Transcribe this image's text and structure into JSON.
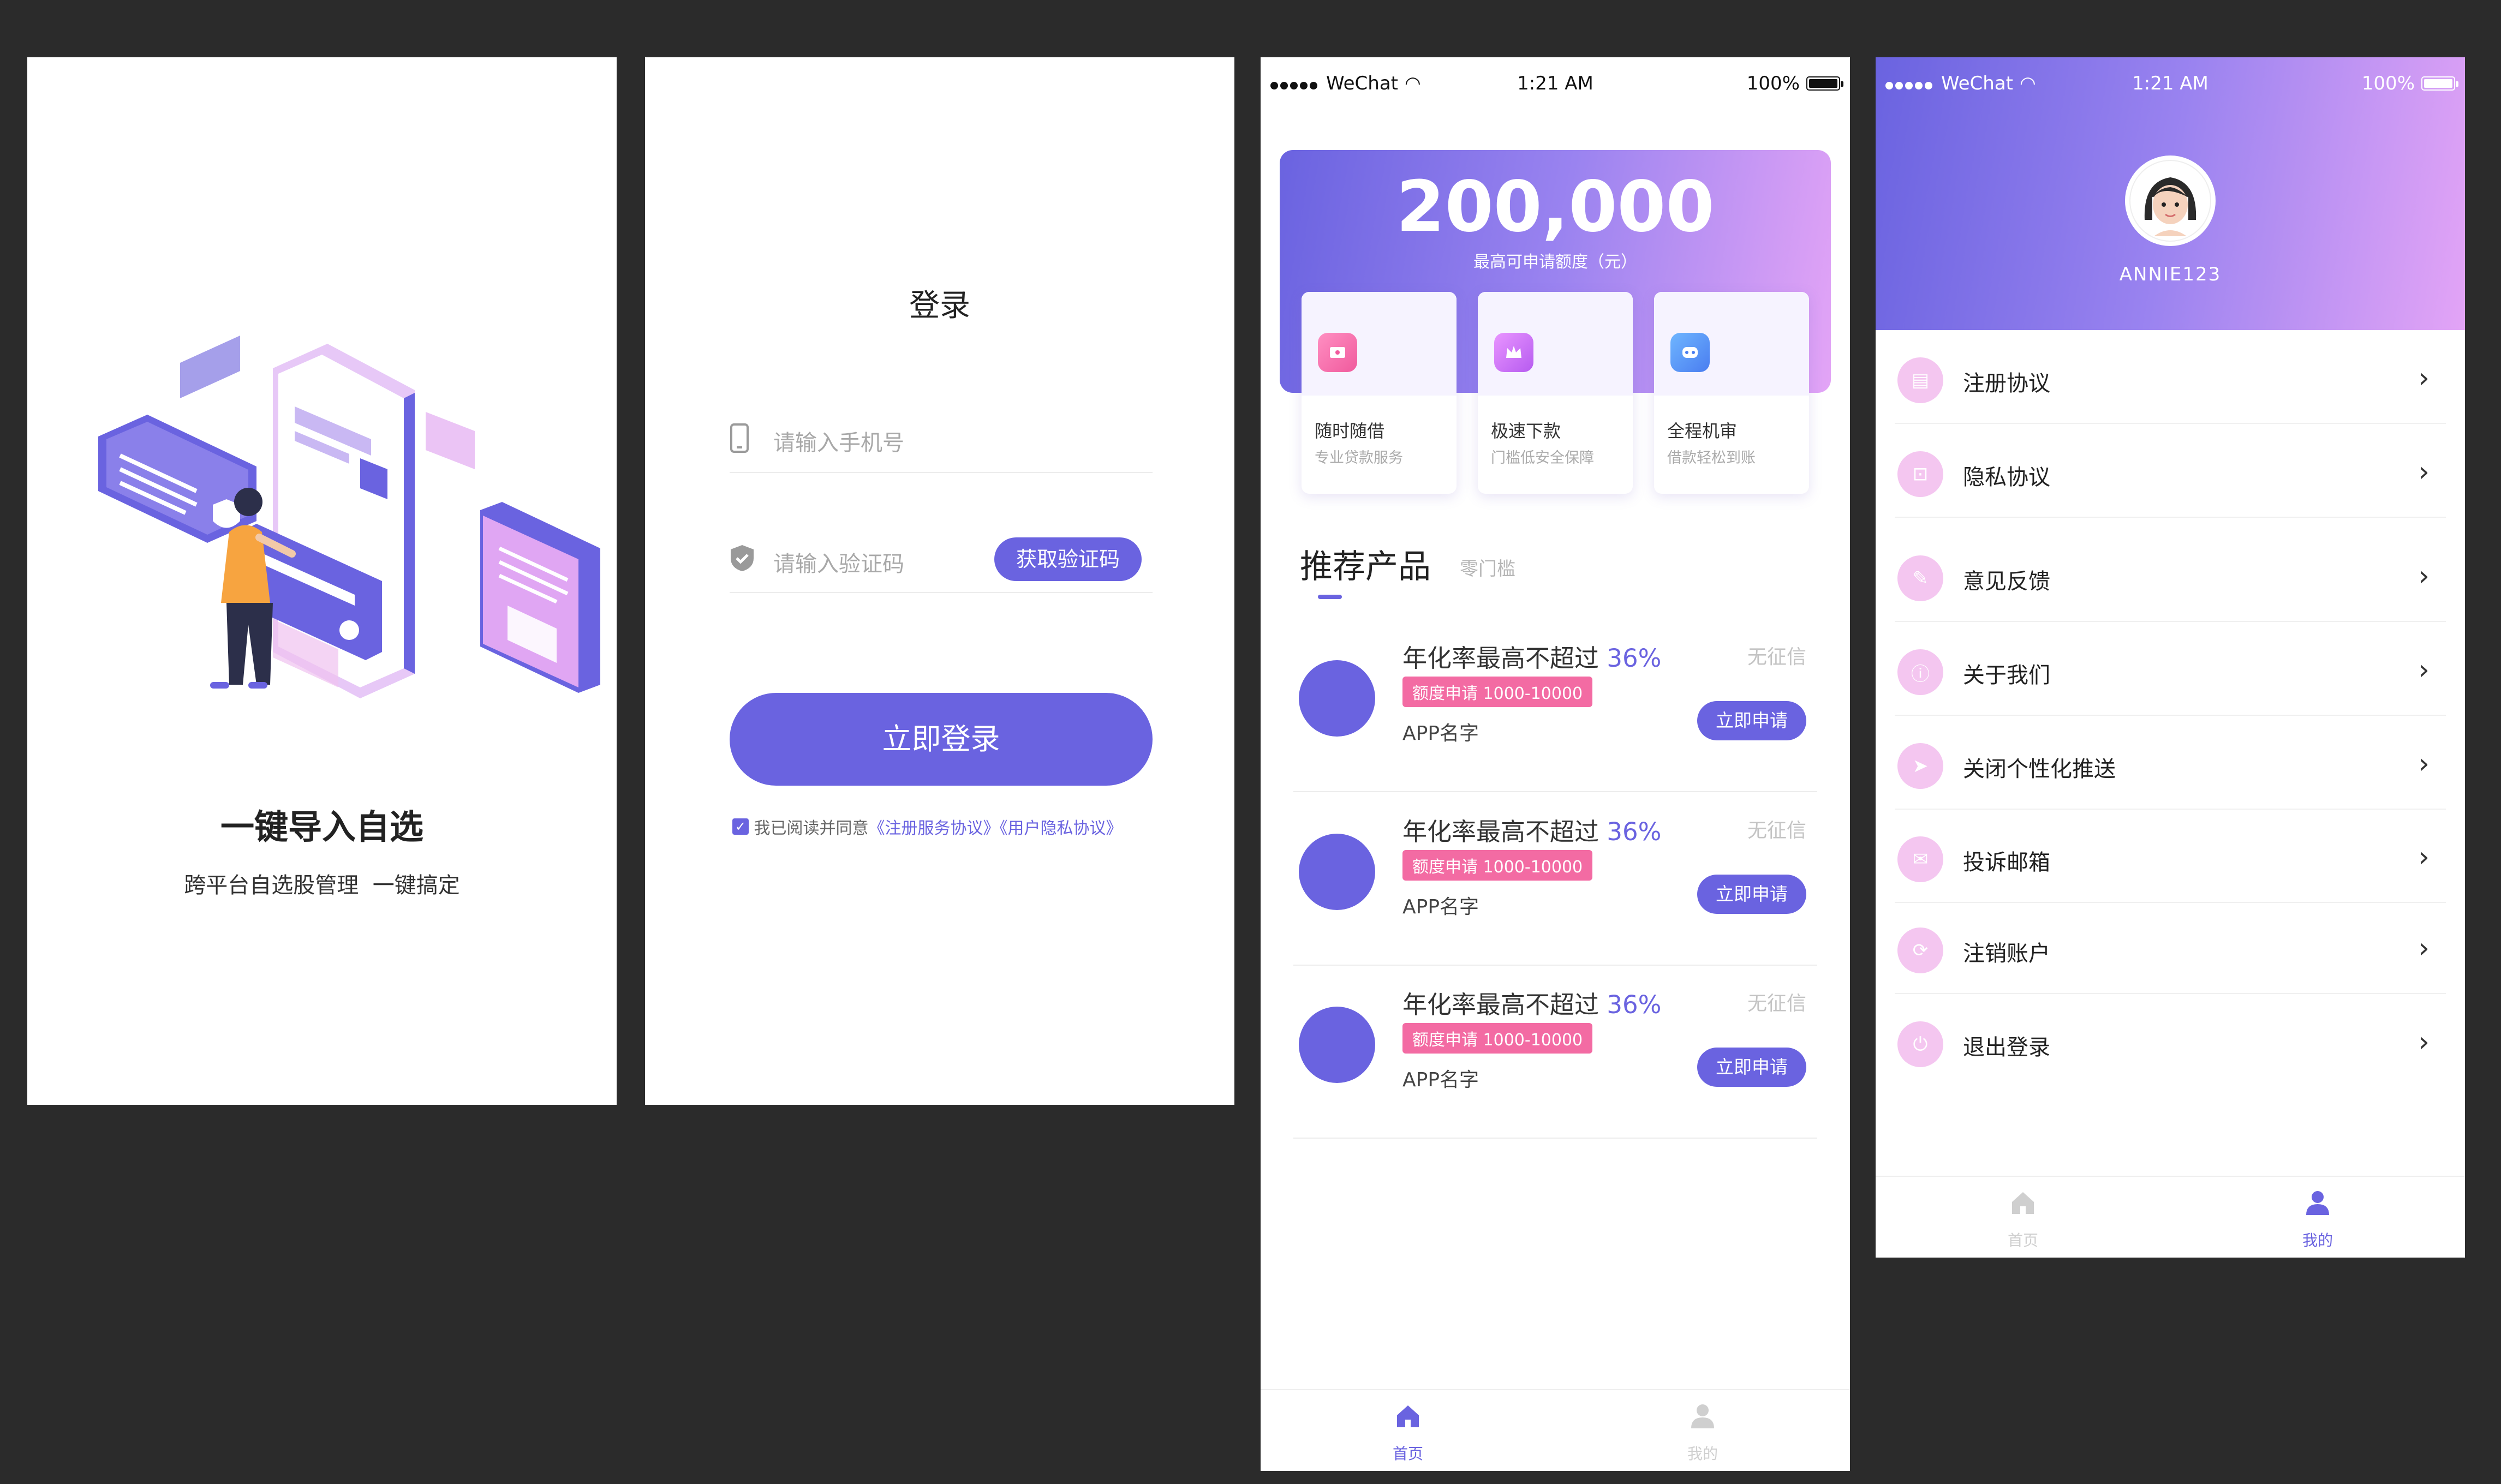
{
  "screen1": {
    "title": "一键导入自选",
    "subtitle": "跨平台自选股管理  一键搞定"
  },
  "screen2": {
    "title": "登录",
    "phone_placeholder": "请输入手机号",
    "code_placeholder": "请输入验证码",
    "get_code_label": "获取验证码",
    "login_label": "立即登录",
    "agreement_prefix": "我已阅读并同意",
    "agreement_links": "《注册服务协议》《用户隐私协议》"
  },
  "status": {
    "carrier": "WeChat",
    "time": "1:21 AM",
    "battery": "100%"
  },
  "screen3": {
    "amount": "200,000",
    "amount_caption": "最高可申请额度（元）",
    "features": [
      {
        "title": "随时随借",
        "sub": "专业贷款服务",
        "icon": "ticket-icon"
      },
      {
        "title": "极速下款",
        "sub": "门槛低安全保障",
        "icon": "crown-icon"
      },
      {
        "title": "全程机审",
        "sub": "借款轻松到账",
        "icon": "robot-icon"
      }
    ],
    "section_title": "推荐产品",
    "section_sub": "零门槛",
    "products": [
      {
        "rate_text": "年化率最高不超过",
        "rate": "36%",
        "tag": "额度申请 1000-10000",
        "name": "APP名字",
        "note": "无征信",
        "button": "立即申请"
      },
      {
        "rate_text": "年化率最高不超过",
        "rate": "36%",
        "tag": "额度申请 1000-10000",
        "name": "APP名字",
        "note": "无征信",
        "button": "立即申请"
      },
      {
        "rate_text": "年化率最高不超过",
        "rate": "36%",
        "tag": "额度申请 1000-10000",
        "name": "APP名字",
        "note": "无征信",
        "button": "立即申请"
      }
    ],
    "tabs": [
      {
        "label": "首页",
        "icon": "home-icon",
        "active": true
      },
      {
        "label": "我的",
        "icon": "user-icon",
        "active": false
      }
    ]
  },
  "screen4": {
    "username": "ANNIE123",
    "menu": [
      {
        "label": "注册协议",
        "icon": "register-icon"
      },
      {
        "label": "隐私协议",
        "icon": "lock-icon"
      },
      {
        "label": "意见反馈",
        "icon": "feedback-icon"
      },
      {
        "label": "关于我们",
        "icon": "info-icon"
      },
      {
        "label": "关闭个性化推送",
        "icon": "send-icon"
      },
      {
        "label": "投诉邮箱",
        "icon": "mail-icon"
      },
      {
        "label": "注销账户",
        "icon": "logout-account-icon"
      },
      {
        "label": "退出登录",
        "icon": "power-icon"
      }
    ],
    "tabs": [
      {
        "label": "首页",
        "icon": "home-icon",
        "active": false
      },
      {
        "label": "我的",
        "icon": "user-icon",
        "active": true
      }
    ]
  },
  "colors": {
    "primary": "#6a63e0",
    "gradient_end": "#e3a4f6",
    "tag_pink": "#f36ba3",
    "background": "#2b2b2b"
  }
}
